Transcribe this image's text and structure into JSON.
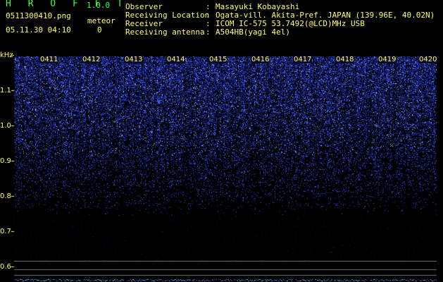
{
  "app": {
    "title": "H R O F F T",
    "version": "1.0.0"
  },
  "file": {
    "name": "0511300410.png",
    "timestamp": "05.11.30 04:10"
  },
  "meteor": {
    "label": "meteor",
    "count": "0"
  },
  "meta": [
    {
      "key": "Observer",
      "sep": ":",
      "value": "Masayuki Kobayashi"
    },
    {
      "key": "Receiving Location",
      "sep": ":",
      "value": "Ogata-vill. Akita-Pref. JAPAN (139.96E, 40.02N)"
    },
    {
      "key": "Receiver",
      "sep": ":",
      "value": "ICOM IC-575 53.7492(@LCD)MHz USB"
    },
    {
      "key": "Receiving antenna",
      "sep": ":",
      "value": "A504HB(yagi 4el)"
    }
  ],
  "spectrogram": {
    "y_unit": "kHz",
    "y_ticks": [
      "1.1",
      "1.0",
      "0.9",
      "0.8",
      "0.7",
      "0.6"
    ],
    "time_ticks": [
      "0411",
      "0412",
      "0413",
      "0414",
      "0415",
      "0416",
      "0417",
      "0418",
      "0419",
      "0420"
    ],
    "colors": {
      "signal": "#3050ff",
      "bright": "#a0c8ff",
      "background": "#000000",
      "axis": "#ffff66",
      "baseline": "#8ab4ff"
    }
  }
}
